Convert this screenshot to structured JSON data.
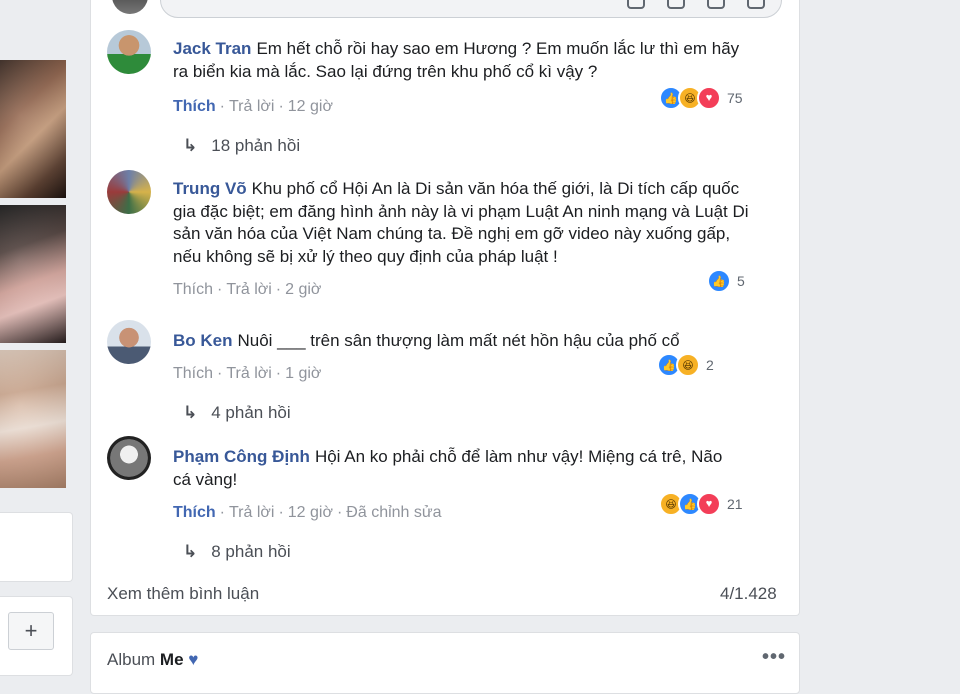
{
  "comments": [
    {
      "author": "Jack Tran",
      "text": "Em hết chỗ rồi hay sao em Hương ? Em muốn lắc lư thì em hãy ra biển kia mà lắc. Sao lại đứng trên khu phố cổ kì vậy ?",
      "like": "Thích",
      "reply": "Trả lời",
      "time": "12 giờ",
      "reactions": [
        "like-icon",
        "haha-icon",
        "love-icon"
      ],
      "reaction_count": "75",
      "replies_label": "18 phản hồi"
    },
    {
      "author": "Trung Võ",
      "text": "Khu phố cổ Hội An là Di sản văn hóa thế giới, là Di tích cấp quốc gia đặc biệt; em đăng hình ảnh này là vi phạm Luật An ninh mạng và Luật Di sản văn hóa của Việt Nam chúng ta. Đề nghị em gỡ video này xuống gấp, nếu không sẽ bị xử lý theo quy định của pháp luật !",
      "like": "Thích",
      "reply": "Trả lời",
      "time": "2 giờ",
      "reactions": [
        "like-icon"
      ],
      "reaction_count": "5"
    },
    {
      "author": "Bo Ken",
      "text": "Nuôi ___ trên sân thượng làm mất nét hồn hậu của phố cổ",
      "like": "Thích",
      "reply": "Trả lời",
      "time": "1 giờ",
      "reactions": [
        "like-icon",
        "haha-icon"
      ],
      "reaction_count": "2",
      "replies_label": "4 phản hồi"
    },
    {
      "author": "Phạm Công Định",
      "text": "Hội An ko phải chỗ để làm như vậy! Miệng cá trê, Não cá vàng!",
      "like": "Thích",
      "reply": "Trả lời",
      "time": "12 giờ",
      "edited": "Đã chỉnh sửa",
      "reactions": [
        "haha-icon",
        "like-icon",
        "love-icon"
      ],
      "reaction_count": "21",
      "replies_label": "8 phản hồi"
    }
  ],
  "footer": {
    "more_comments": "Xem thêm bình luận",
    "count": "4/1.428"
  },
  "album": {
    "prefix": "Album",
    "name": "Me",
    "heart": "♥"
  },
  "left": {
    "plus": "+"
  },
  "colors": {
    "link": "#385898",
    "like": "#4267b2",
    "meta": "#90949c",
    "background": "#ebedf0"
  }
}
